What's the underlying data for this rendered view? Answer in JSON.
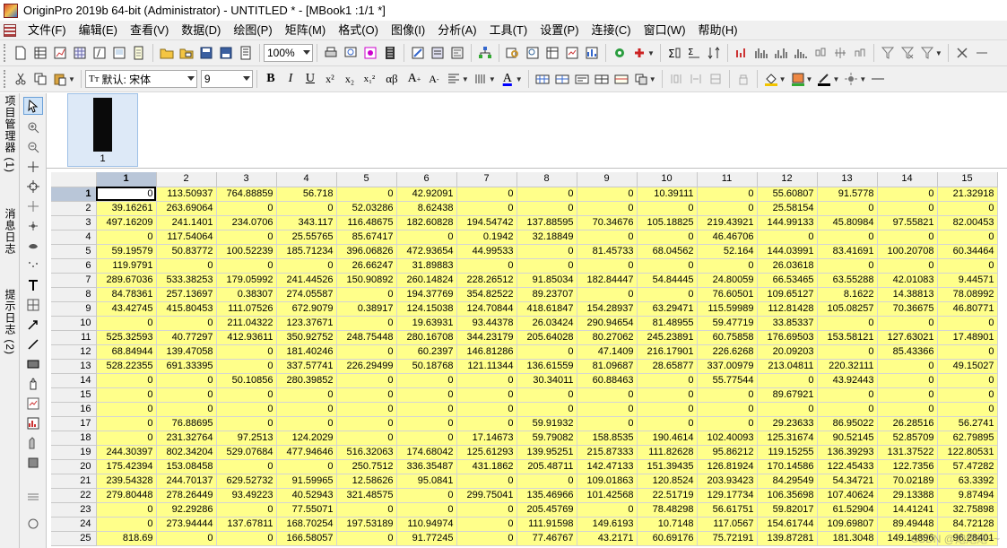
{
  "title": "OriginPro 2019b 64-bit (Administrator) - UNTITLED * - [MBook1 :1/1  *]",
  "menu": [
    "文件(F)",
    "编辑(E)",
    "查看(V)",
    "数据(D)",
    "绘图(P)",
    "矩阵(M)",
    "格式(O)",
    "图像(I)",
    "分析(A)",
    "工具(T)",
    "设置(P)",
    "连接(C)",
    "窗口(W)",
    "帮助(H)"
  ],
  "toolbar1": {
    "zoom": "100%"
  },
  "toolbar2": {
    "font_name": "默认: 宋体",
    "font_size": "9"
  },
  "side_tabs": [
    "项目管理器 (1)",
    "消息日志",
    "提示日志 (2)"
  ],
  "sheet": {
    "thumb_label": "1"
  },
  "grid": {
    "columns": [
      "1",
      "2",
      "3",
      "4",
      "5",
      "6",
      "7",
      "8",
      "9",
      "10",
      "11",
      "12",
      "13",
      "14",
      "15"
    ],
    "rows": [
      {
        "r": "1",
        "v": [
          "0",
          "113.50937",
          "764.88859",
          "56.718",
          "0",
          "42.92091",
          "0",
          "0",
          "0",
          "10.39111",
          "0",
          "55.60807",
          "91.5778",
          "0",
          "21.32918"
        ]
      },
      {
        "r": "2",
        "v": [
          "39.16261",
          "263.69064",
          "0",
          "0",
          "52.03286",
          "8.62438",
          "0",
          "0",
          "0",
          "0",
          "0",
          "25.58154",
          "0",
          "0",
          "0"
        ]
      },
      {
        "r": "3",
        "v": [
          "497.16209",
          "241.1401",
          "234.0706",
          "343.117",
          "116.48675",
          "182.60828",
          "194.54742",
          "137.88595",
          "70.34676",
          "105.18825",
          "219.43921",
          "144.99133",
          "45.80984",
          "97.55821",
          "82.00453"
        ]
      },
      {
        "r": "4",
        "v": [
          "0",
          "117.54064",
          "0",
          "25.55765",
          "85.67417",
          "0",
          "0.1942",
          "32.18849",
          "0",
          "0",
          "46.46706",
          "0",
          "0",
          "0",
          "0"
        ]
      },
      {
        "r": "5",
        "v": [
          "59.19579",
          "50.83772",
          "100.52239",
          "185.71234",
          "396.06826",
          "472.93654",
          "44.99533",
          "0",
          "81.45733",
          "68.04562",
          "52.164",
          "144.03991",
          "83.41691",
          "100.20708",
          "60.34464"
        ]
      },
      {
        "r": "6",
        "v": [
          "119.9791",
          "0",
          "0",
          "0",
          "26.66247",
          "31.89883",
          "0",
          "0",
          "0",
          "0",
          "0",
          "26.03618",
          "0",
          "0",
          "0"
        ]
      },
      {
        "r": "7",
        "v": [
          "289.67036",
          "533.38253",
          "179.05992",
          "241.44526",
          "150.90892",
          "260.14824",
          "228.26512",
          "91.85034",
          "182.84447",
          "54.84445",
          "24.80059",
          "66.53465",
          "63.55288",
          "42.01083",
          "9.44571"
        ]
      },
      {
        "r": "8",
        "v": [
          "84.78361",
          "257.13697",
          "0.38307",
          "274.05587",
          "0",
          "194.37769",
          "354.82522",
          "89.23707",
          "0",
          "0",
          "76.60501",
          "109.65127",
          "8.1622",
          "14.38813",
          "78.08992"
        ]
      },
      {
        "r": "9",
        "v": [
          "43.42745",
          "415.80453",
          "111.07526",
          "672.9079",
          "0.38917",
          "124.15038",
          "124.70844",
          "418.61847",
          "154.28937",
          "63.29471",
          "115.59989",
          "112.81428",
          "105.08257",
          "70.36675",
          "46.80771"
        ]
      },
      {
        "r": "10",
        "v": [
          "0",
          "0",
          "211.04322",
          "123.37671",
          "0",
          "19.63931",
          "93.44378",
          "26.03424",
          "290.94654",
          "81.48955",
          "59.47719",
          "33.85337",
          "0",
          "0",
          "0"
        ]
      },
      {
        "r": "11",
        "v": [
          "525.32593",
          "40.77297",
          "412.93611",
          "350.92752",
          "248.75448",
          "280.16708",
          "344.23179",
          "205.64028",
          "80.27062",
          "245.23891",
          "60.75858",
          "176.69503",
          "153.58121",
          "127.63021",
          "17.48901"
        ]
      },
      {
        "r": "12",
        "v": [
          "68.84944",
          "139.47058",
          "0",
          "181.40246",
          "0",
          "60.2397",
          "146.81286",
          "0",
          "47.1409",
          "216.17901",
          "226.6268",
          "20.09203",
          "0",
          "85.43366",
          "0"
        ]
      },
      {
        "r": "13",
        "v": [
          "528.22355",
          "691.33395",
          "0",
          "337.57741",
          "226.29499",
          "50.18768",
          "121.11344",
          "136.61559",
          "81.09687",
          "28.65877",
          "337.00979",
          "213.04811",
          "220.32111",
          "0",
          "49.15027"
        ]
      },
      {
        "r": "14",
        "v": [
          "0",
          "0",
          "50.10856",
          "280.39852",
          "0",
          "0",
          "0",
          "30.34011",
          "60.88463",
          "0",
          "55.77544",
          "0",
          "43.92443",
          "0",
          "0"
        ]
      },
      {
        "r": "15",
        "v": [
          "0",
          "0",
          "0",
          "0",
          "0",
          "0",
          "0",
          "0",
          "0",
          "0",
          "0",
          "89.67921",
          "0",
          "0",
          "0"
        ]
      },
      {
        "r": "16",
        "v": [
          "0",
          "0",
          "0",
          "0",
          "0",
          "0",
          "0",
          "0",
          "0",
          "0",
          "0",
          "0",
          "0",
          "0",
          "0"
        ]
      },
      {
        "r": "17",
        "v": [
          "0",
          "76.88695",
          "0",
          "0",
          "0",
          "0",
          "0",
          "59.91932",
          "0",
          "0",
          "0",
          "29.23633",
          "86.95022",
          "26.28516",
          "56.2741"
        ]
      },
      {
        "r": "18",
        "v": [
          "0",
          "231.32764",
          "97.2513",
          "124.2029",
          "0",
          "0",
          "17.14673",
          "59.79082",
          "158.8535",
          "190.4614",
          "102.40093",
          "125.31674",
          "90.52145",
          "52.85709",
          "62.79895"
        ]
      },
      {
        "r": "19",
        "v": [
          "244.30397",
          "802.34204",
          "529.07684",
          "477.94646",
          "516.32063",
          "174.68042",
          "125.61293",
          "139.95251",
          "215.87333",
          "111.82628",
          "95.86212",
          "119.15255",
          "136.39293",
          "131.37522",
          "122.80531"
        ]
      },
      {
        "r": "20",
        "v": [
          "175.42394",
          "153.08458",
          "0",
          "0",
          "250.7512",
          "336.35487",
          "431.1862",
          "205.48711",
          "142.47133",
          "151.39435",
          "126.81924",
          "170.14586",
          "122.45433",
          "122.7356",
          "57.47282"
        ]
      },
      {
        "r": "21",
        "v": [
          "239.54328",
          "244.70137",
          "629.52732",
          "91.59965",
          "12.58626",
          "95.0841",
          "0",
          "0",
          "109.01863",
          "120.8524",
          "203.93423",
          "84.29549",
          "54.34721",
          "70.02189",
          "63.3392"
        ]
      },
      {
        "r": "22",
        "v": [
          "279.80448",
          "278.26449",
          "93.49223",
          "40.52943",
          "321.48575",
          "0",
          "299.75041",
          "135.46966",
          "101.42568",
          "22.51719",
          "129.17734",
          "106.35698",
          "107.40624",
          "29.13388",
          "9.87494"
        ]
      },
      {
        "r": "23",
        "v": [
          "0",
          "92.29286",
          "0",
          "77.55071",
          "0",
          "0",
          "0",
          "205.45769",
          "0",
          "78.48298",
          "56.61751",
          "59.82017",
          "61.52904",
          "14.41241",
          "32.75898"
        ]
      },
      {
        "r": "24",
        "v": [
          "0",
          "273.94444",
          "137.67811",
          "168.70254",
          "197.53189",
          "110.94974",
          "0",
          "111.91598",
          "149.6193",
          "10.7148",
          "117.0567",
          "154.61744",
          "109.69807",
          "89.49448",
          "84.72128"
        ]
      },
      {
        "r": "25",
        "v": [
          "818.69",
          "0",
          "0",
          "166.58057",
          "0",
          "91.77245",
          "0",
          "77.46767",
          "43.2171",
          "60.69176",
          "75.72191",
          "139.87281",
          "181.3048",
          "149.14896",
          "96.28401"
        ]
      }
    ]
  },
  "watermark": "CSDN @炮炮炮~~"
}
